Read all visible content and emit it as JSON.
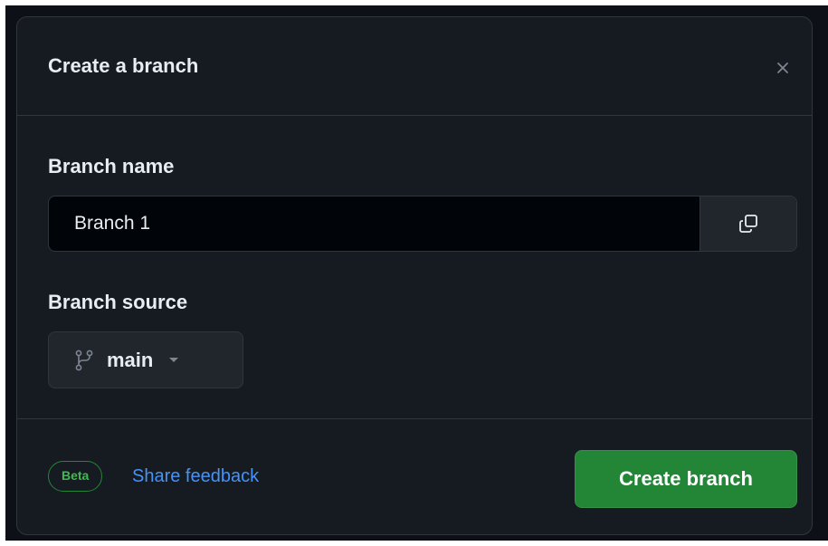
{
  "dialog": {
    "title": "Create a branch",
    "close_icon": "close-icon"
  },
  "branch_name": {
    "label": "Branch name",
    "value": "Branch 1",
    "copy_icon": "copy-icon"
  },
  "branch_source": {
    "label": "Branch source",
    "selected": "main",
    "branch_icon": "git-branch-icon",
    "caret_icon": "triangle-down-icon"
  },
  "footer": {
    "badge": "Beta",
    "feedback_link": "Share feedback",
    "create_button": "Create branch"
  },
  "colors": {
    "background": "#161b22",
    "border": "#30363d",
    "input_bg": "#010409",
    "text": "#e6edf3",
    "muted": "#7d8590",
    "link": "#4493f8",
    "primary": "#238636",
    "badge_text": "#3fb950"
  }
}
